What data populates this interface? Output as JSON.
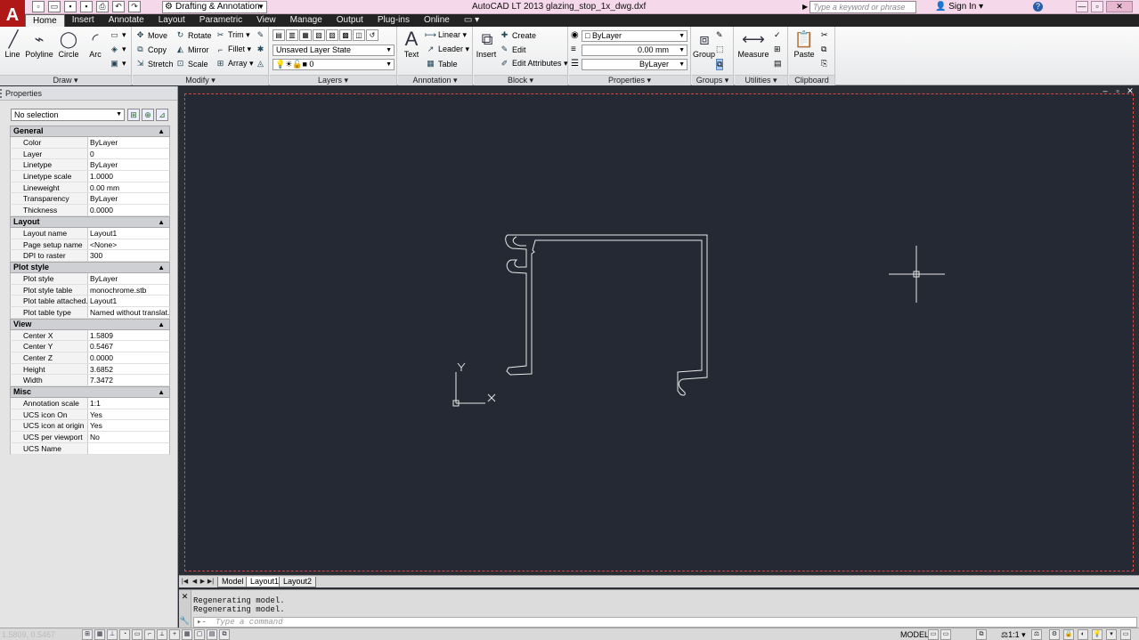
{
  "app": {
    "logo": "A",
    "title": "AutoCAD LT 2013    glazing_stop_1x_dwg.dxf",
    "workspace": "Drafting & Annotation",
    "search_placeholder": "Type a keyword or phrase",
    "signin": "Sign In",
    "help": "?"
  },
  "tabs": [
    "Home",
    "Insert",
    "Annotate",
    "Layout",
    "Parametric",
    "View",
    "Manage",
    "Output",
    "Plug-ins",
    "Online"
  ],
  "ribbon": {
    "draw": {
      "label": "Draw ▾",
      "line": "Line",
      "polyline": "Polyline",
      "circle": "Circle",
      "arc": "Arc"
    },
    "modify": {
      "label": "Modify ▾",
      "move": "Move",
      "rotate": "Rotate",
      "trim": "Trim ▾",
      "copy": "Copy",
      "mirror": "Mirror",
      "fillet": "Fillet ▾",
      "stretch": "Stretch",
      "scale": "Scale",
      "array": "Array ▾"
    },
    "layers": {
      "label": "Layers ▾",
      "layer_state": "Unsaved Layer State",
      "current_layer": "0"
    },
    "annotation": {
      "label": "Annotation ▾",
      "text": "Text",
      "linear": "Linear ▾",
      "leader": "Leader ▾",
      "table": "Table"
    },
    "block": {
      "label": "Block ▾",
      "insert": "Insert",
      "create": "Create",
      "edit": "Edit",
      "edit_attributes": "Edit Attributes ▾"
    },
    "properties": {
      "label": "Properties ▾",
      "color": "ByLayer",
      "lineweight": "0.00 mm",
      "linetype": "ByLayer"
    },
    "groups": {
      "label": "Groups ▾",
      "group": "Group"
    },
    "utilities": {
      "label": "Utilities ▾",
      "measure": "Measure"
    },
    "clipboard": {
      "label": "Clipboard",
      "paste": "Paste"
    }
  },
  "properties_palette": {
    "title": "Properties",
    "selection": "No selection",
    "sections": [
      {
        "name": "General",
        "rows": [
          [
            "Color",
            "ByLayer"
          ],
          [
            "Layer",
            "0"
          ],
          [
            "Linetype",
            "ByLayer"
          ],
          [
            "Linetype scale",
            "1.0000"
          ],
          [
            "Lineweight",
            "0.00 mm"
          ],
          [
            "Transparency",
            "ByLayer"
          ],
          [
            "Thickness",
            "0.0000"
          ]
        ]
      },
      {
        "name": "Layout",
        "rows": [
          [
            "Layout name",
            "Layout1"
          ],
          [
            "Page setup name",
            "<None>"
          ],
          [
            "DPI to raster",
            "300"
          ]
        ]
      },
      {
        "name": "Plot style",
        "rows": [
          [
            "Plot style",
            "ByLayer"
          ],
          [
            "Plot style table",
            "monochrome.stb"
          ],
          [
            "Plot table attached...",
            "Layout1"
          ],
          [
            "Plot table type",
            "Named without translat..."
          ]
        ]
      },
      {
        "name": "View",
        "rows": [
          [
            "Center X",
            "1.5809"
          ],
          [
            "Center Y",
            "0.5467"
          ],
          [
            "Center Z",
            "0.0000"
          ],
          [
            "Height",
            "3.6852"
          ],
          [
            "Width",
            "7.3472"
          ]
        ]
      },
      {
        "name": "Misc",
        "rows": [
          [
            "Annotation scale",
            "1:1"
          ],
          [
            "UCS icon On",
            "Yes"
          ],
          [
            "UCS icon at origin",
            "Yes"
          ],
          [
            "UCS per viewport",
            "No"
          ],
          [
            "UCS Name",
            ""
          ]
        ]
      }
    ]
  },
  "viewport": {
    "ucs_x": "X",
    "ucs_y": "Y"
  },
  "layout_tabs": [
    "Model",
    "Layout1",
    "Layout2"
  ],
  "command": {
    "history": [
      "Regenerating model.",
      "Regenerating model."
    ],
    "placeholder": "Type a command"
  },
  "statusbar": {
    "model": "MODEL",
    "coords": "1.5809, 0.5467",
    "scale": "1:1"
  },
  "colors": {
    "canvas": "#242933",
    "viewport_border": "#d84848",
    "tab_bar": "#232323",
    "titlebar": "#f5d8ea"
  }
}
